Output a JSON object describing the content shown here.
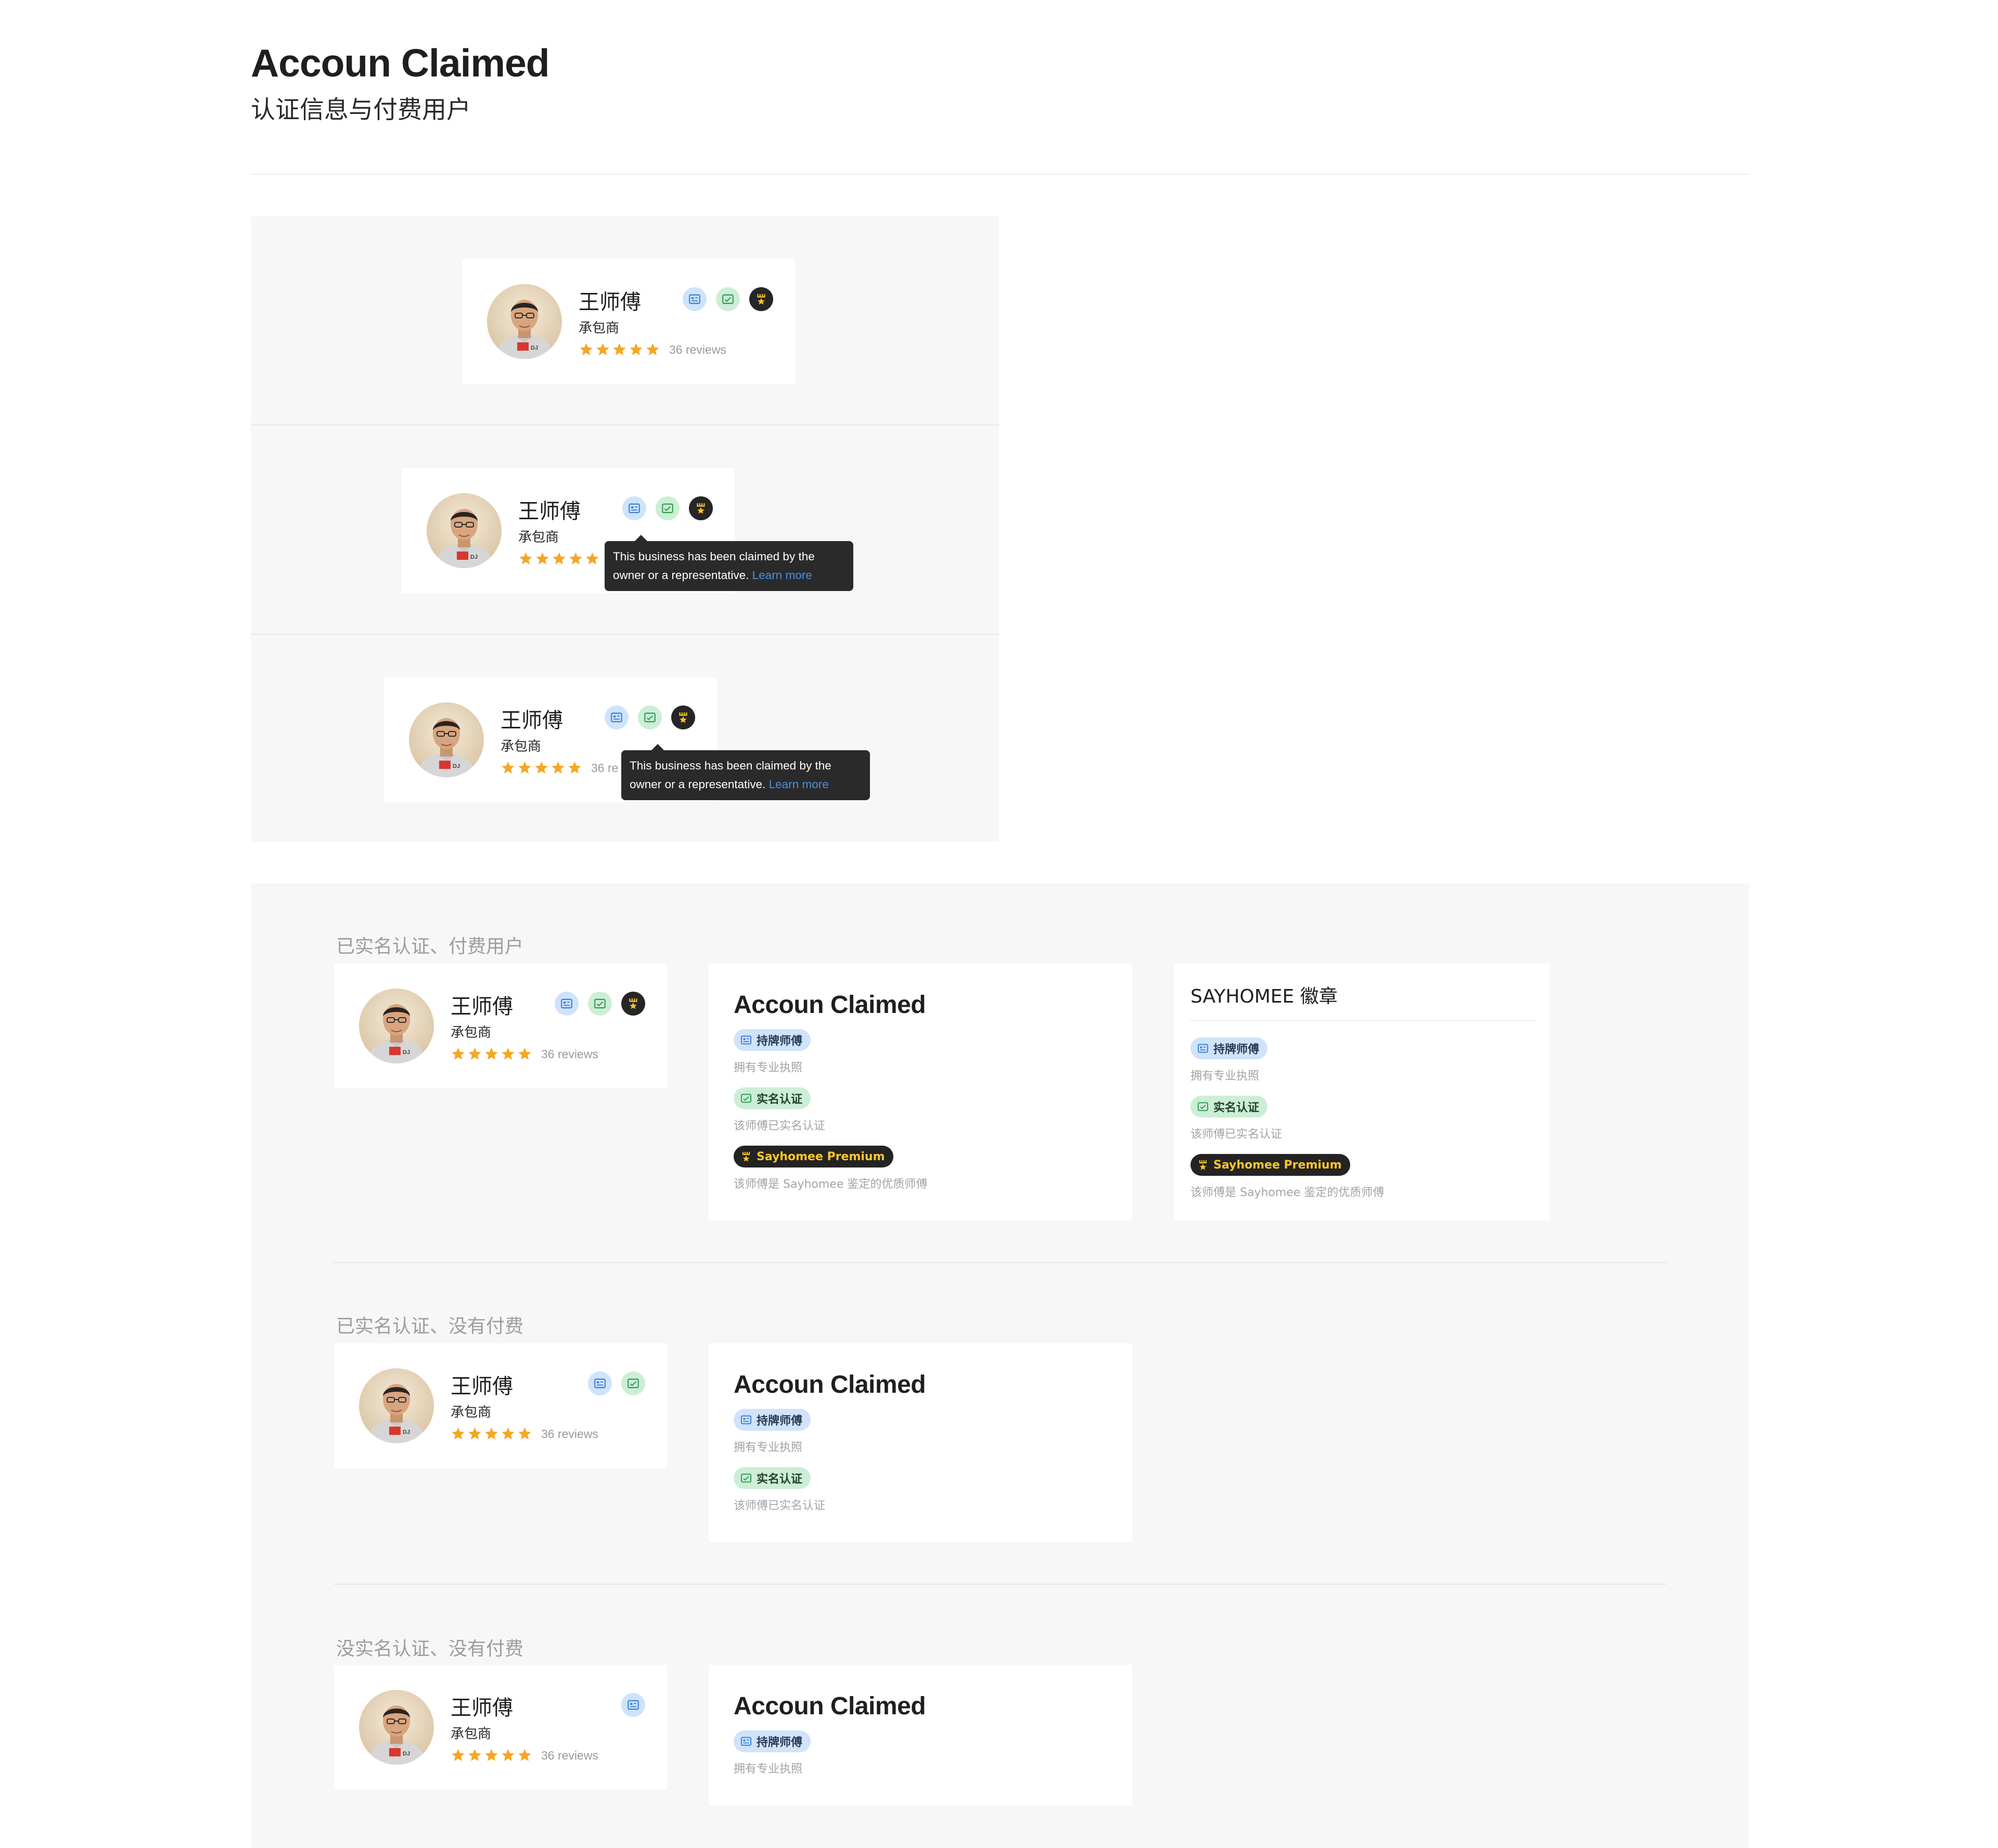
{
  "header": {
    "title": "Accoun Claimed",
    "subtitle": "认证信息与付费用户"
  },
  "profile": {
    "name": "王师傅",
    "role": "承包商",
    "rating": 5,
    "reviews_full": "36 reviews",
    "reviews_clipped": "36 re"
  },
  "tooltip": {
    "line1": "This business has been claimed by the",
    "line2": "owner or a representative.",
    "link": "Learn more"
  },
  "sections": [
    {
      "label": "已实名认证、付费用户"
    },
    {
      "label": "已实名认证、没有付费"
    },
    {
      "label": "没实名认证、没有付费"
    }
  ],
  "legend": {
    "title": "Accoun Claimed",
    "licensed_label": "持牌师傅",
    "licensed_desc": "拥有专业执照",
    "verified_label": "实名认证",
    "verified_desc": "该师傅已实名认证",
    "premium_label": "Sayhomee Premium",
    "premium_desc": "该师傅是 Sayhomee 鉴定的优质师傅"
  },
  "sayhomee_badges": {
    "title": "SAYHOMEE 徽章"
  },
  "colors": {
    "star": "#f5a623",
    "blue_badge_bg": "#cfe3fb",
    "blue_badge_icon": "#3b82d6",
    "green_badge_bg": "#cdeed6",
    "green_badge_icon": "#2f9d55",
    "premium_bg": "#232323",
    "premium_text": "#ffc627",
    "link": "#4a90e2"
  },
  "icons": {
    "licensed": "id-card-icon",
    "verified": "verified-check-icon",
    "premium": "premium-crown-star-icon",
    "rating": "star-icon"
  }
}
